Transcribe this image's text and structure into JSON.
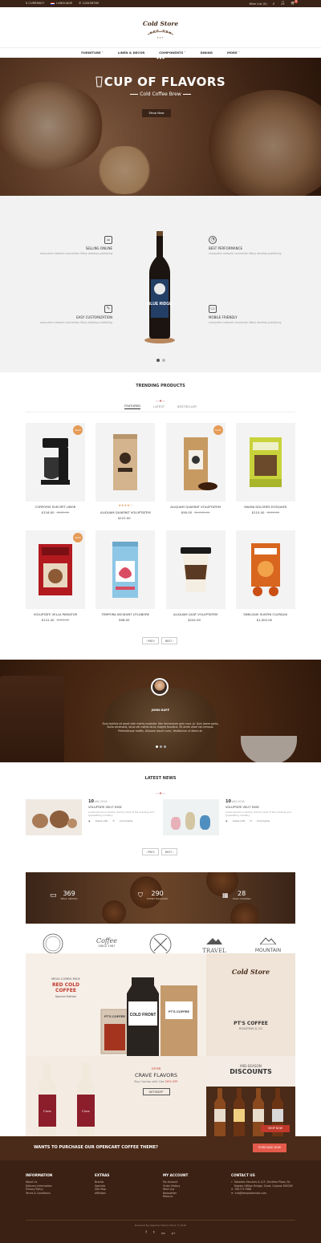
{
  "topbar": {
    "currency": "$ CURRENCY",
    "language": "LANGUAGE",
    "phone": "123456789",
    "wishlist": "Wish List (0)",
    "cart_count": "0"
  },
  "logo": {
    "title": "Cold Store",
    "caption": "EST"
  },
  "nav": [
    "FURNITURE",
    "LINEN & DECOR",
    "COMPONENTS",
    "DINING",
    "MORE"
  ],
  "hero": {
    "badge_since": "SINCE 1983",
    "badge_name": "COLD BREW",
    "badge_sub": "THE COFFEE SHOP",
    "title": "CUP OF FLAVORS",
    "subtitle": "Cold Coffee Brew",
    "button": "Shop Now"
  },
  "features": [
    {
      "title": "SELLING ONLINE",
      "text": "computers network connection Many desktop publishing",
      "icon": "cup-icon"
    },
    {
      "title": "EASY CUSTOMIZATION",
      "text": "computers network connection Many desktop publishing",
      "icon": "brush-icon"
    },
    {
      "title": "BEST PERFORMANCE",
      "text": "computers network connection Many desktop publishing",
      "icon": "gauge-icon"
    },
    {
      "title": "MOBILE FRIENDLY",
      "text": "computers network connection Many desktop publishing",
      "icon": "laptop-icon"
    }
  ],
  "bottle_label": "BLUE RIDGE",
  "trending": {
    "title": "TRENDING PRODUCTS",
    "tabs": [
      "FEATURED",
      "LATEST",
      "BESTSELLER"
    ],
    "sale_label": "SALE",
    "products": [
      {
        "name": "CORPORIS SUSCIPIT LIBOR",
        "price": "$116.00",
        "old": "$122.00",
        "sale": true,
        "stars": "",
        "kind": "coffee-maker"
      },
      {
        "name": "ALIQUAM QUAERAT VOLUPTATEM",
        "price": "$122.00",
        "old": "",
        "sale": false,
        "stars": "★★★★☆",
        "kind": "coffee-bag"
      },
      {
        "name": "ALIQUAM QUAERAT VOLUPTATEM",
        "price": "$90.00",
        "old": "$1,000.00",
        "sale": true,
        "stars": "",
        "kind": "coffee-bag-brown"
      },
      {
        "name": "MAGNI DOLORES EOSQUIES",
        "price": "$110.40",
        "old": "$122.00",
        "sale": false,
        "stars": "",
        "kind": "cafe-box"
      },
      {
        "name": "VOLUPTATE VELLA PARIATUR",
        "price": "$112.40",
        "old": "$122.00",
        "sale": true,
        "stars": "",
        "kind": "nescafe-box"
      },
      {
        "name": "TEMPORA INCIDUNT UTLABORE",
        "price": "$98.00",
        "old": "",
        "sale": false,
        "stars": "",
        "kind": "blue-bag"
      },
      {
        "name": "ALIQUAM QUAT VOLUPTATEM",
        "price": "$242.00",
        "old": "",
        "sale": false,
        "stars": "",
        "kind": "paper-cup"
      },
      {
        "name": "SIMILIQUE SUNTIN CULPAQUI",
        "price": "$1,002.00",
        "old": "",
        "sale": false,
        "stars": "",
        "kind": "capsule-box"
      }
    ],
    "prev": "PREV",
    "next": "NEXT"
  },
  "testimonial": {
    "name": "JOHN DUFF",
    "text": "Duis facilisis sit amet nibh mattis molestie. Nec fermentum quis nunc ut. Quis lorem porta, Nulla venenatis, lacus vel mattis lacus magna faucibus. Sit amet vitae nec tempus. Pellentesque mattis, Aliquam ipsum nunc, Vestibulum ut libero et."
  },
  "news": {
    "title": "LATEST NEWS",
    "items": [
      {
        "day": "10",
        "month": "JAN 2016",
        "title": "VOLUPTATE VELIT ESSE",
        "text": "Lorem Ipsum is simply dummy text of the printing and typesetting industry.",
        "views": "Views (18)",
        "comments": "Comments"
      },
      {
        "day": "10",
        "month": "JAN 2016",
        "title": "VOLUPTATE VELIT ESSE",
        "text": "Lorem Ipsum is simply dummy text of the printing and typesetting industry.",
        "views": "Views (18)",
        "comments": "Comments"
      }
    ],
    "prev": "PREV",
    "next": "NEXT"
  },
  "counters": [
    {
      "num": "369",
      "label": "MEAL SERVED"
    },
    {
      "num": "290",
      "label": "EVENT MANAGED"
    },
    {
      "num": "28",
      "label": "YEAR COOKING"
    }
  ],
  "brands": [
    {
      "top": "ROYAL BARBER",
      "bottom": "PREMIUM"
    },
    {
      "top": "Coffee",
      "bottom": "SINCE 1987"
    },
    {
      "top": "",
      "bottom": ""
    },
    {
      "top": "TRAVEL",
      "bottom": "HOLIDAY RESORT"
    },
    {
      "top": "MOUNTAIN",
      "bottom": "CLIMBING · 1987"
    }
  ],
  "banners": {
    "b1_kicker": "MEGA COMBO PACK",
    "b1_title": "RED COLD COFFEE",
    "b1_sub": "Special Edition",
    "b1_cup": "PT'S COFFEE",
    "b1_bottle": "COLD FRONT",
    "b2_logo": "Cold Store",
    "b2_title": "PT'S COFFEE",
    "b2_sub": "ROASTING & CO",
    "b3_kicker": "OFFER",
    "b3_title": "CRAVE FLAVORS",
    "b3_text": "Buy Combo with Get",
    "b3_off": "20% OFF",
    "b3_button": "GET35OFF",
    "b3_label": "Crave",
    "b4_kicker": "MID-SEASON",
    "b4_title": "DISCOUNTS",
    "b4_button": "SHOP NOW"
  },
  "purchase": {
    "text": "WANTS TO PURCHASE OUR OPENCART COFFEE THEME?",
    "button": "PURCHASE NOW"
  },
  "footer": {
    "cols": [
      {
        "title": "INFORMATION",
        "items": [
          "About Us",
          "Delivery Information",
          "Privacy Policy",
          "Terms & Conditions"
        ]
      },
      {
        "title": "EXTRAS",
        "items": [
          "Brands",
          "Specials",
          "Site Map",
          "Affiliates"
        ]
      },
      {
        "title": "MY ACCOUNT",
        "items": [
          "My Account",
          "Order History",
          "Wish List",
          "Newsletter",
          "Returns"
        ]
      }
    ],
    "contact_title": "CONTACT US",
    "address": "Tabaldez Services & LCF, Shridhar Plaza, Nr. Rajeshri Milton Bridge, Surat, Gujarat-395006",
    "phone": "9917717988",
    "email": "info@templatemela.com",
    "copyright": "Powered By OpenCart Demo Store © 2016",
    "social": [
      "f",
      "t",
      "rss",
      "g+"
    ]
  }
}
